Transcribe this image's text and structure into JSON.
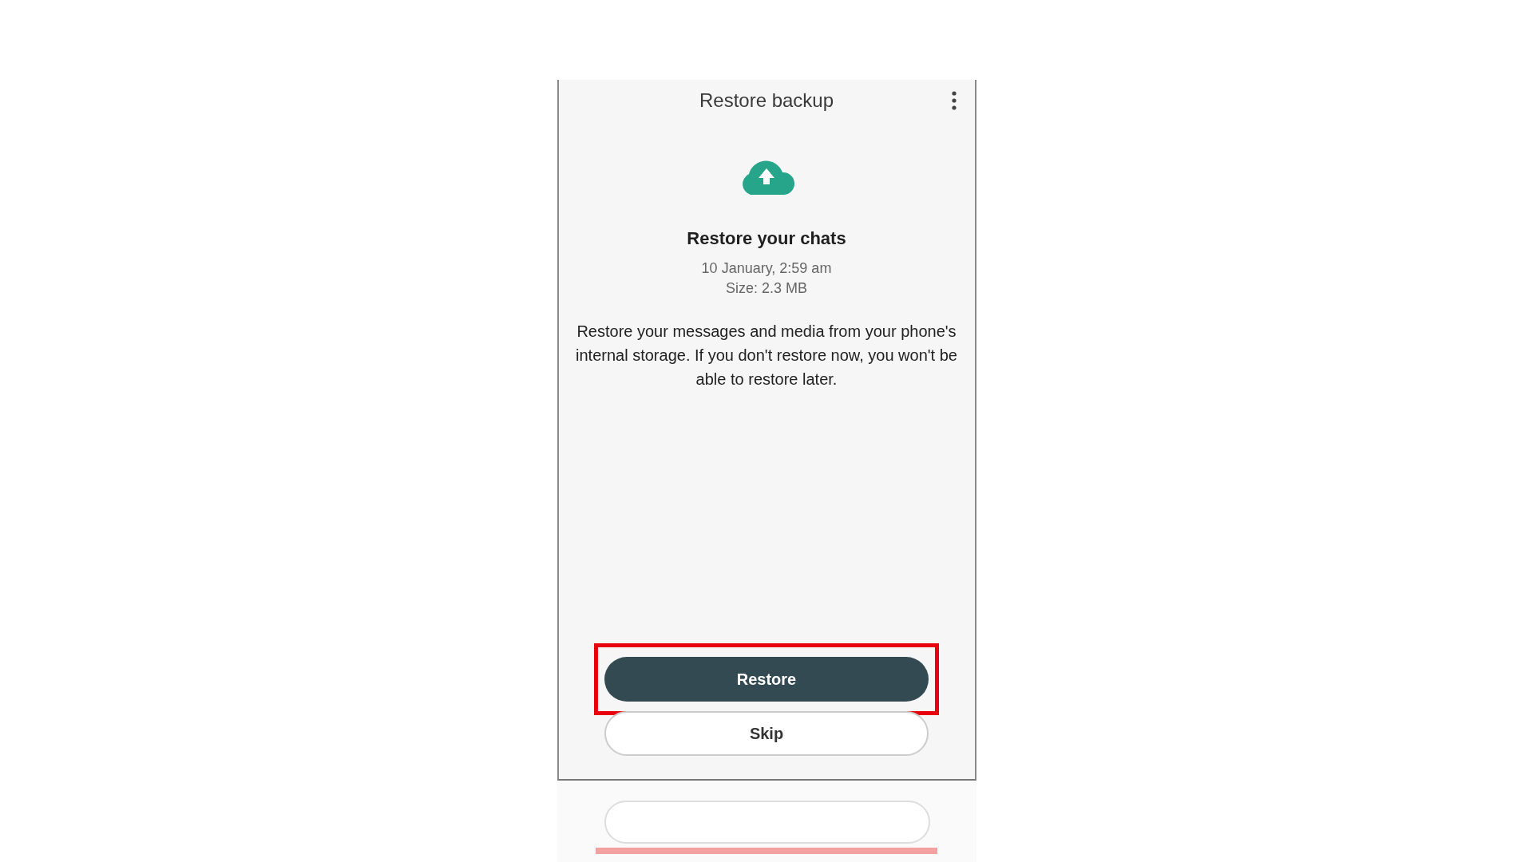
{
  "header": {
    "title": "Restore backup"
  },
  "backup": {
    "heading": "Restore your chats",
    "date": "10 January, 2:59 am",
    "size": "Size: 2.3 MB",
    "description": "Restore your messages and media from your phone's internal storage. If you don't restore now, you won't be able to restore later."
  },
  "buttons": [
    {
      "label": "Restore",
      "kind": "primary",
      "highlighted": true
    },
    {
      "label": "Skip",
      "kind": "secondary",
      "highlighted": false
    }
  ]
}
